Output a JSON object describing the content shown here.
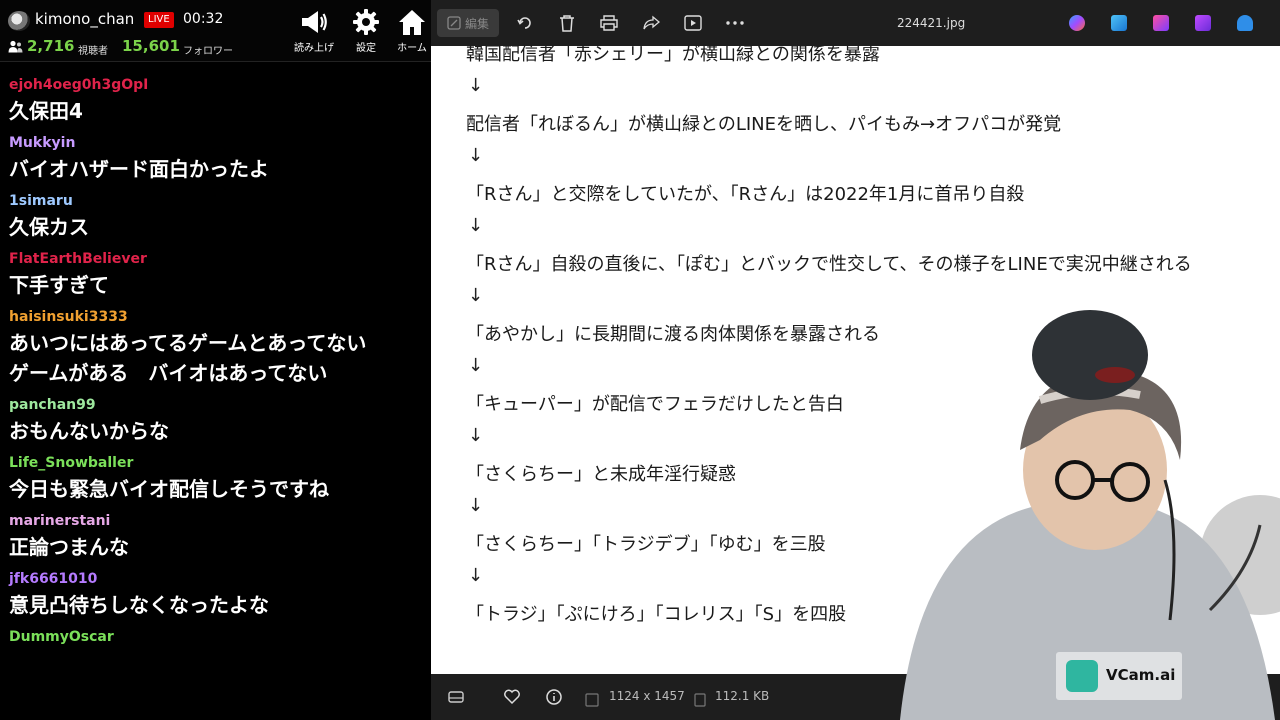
{
  "stream": {
    "channel_name": "kimono_chan",
    "live_badge": "LIVE",
    "elapsed": "00:32",
    "viewer_count": "2,716",
    "viewer_label": "視聴者",
    "follower_count": "15,601",
    "follower_label": "フォロワー"
  },
  "toolbar": {
    "readout_label": "読み上げ",
    "settings_label": "設定",
    "home_label": "ホーム"
  },
  "chat": [
    {
      "user": "ejoh4oeg0h3gOpI",
      "color": "#e0234a",
      "message": "久保田4"
    },
    {
      "user": "Mukkyin",
      "color": "#c79bff",
      "message": "バイオハザード面白かったよ"
    },
    {
      "user": "1simaru",
      "color": "#9ec9ff",
      "message": "久保カス"
    },
    {
      "user": "FlatEarthBeliever",
      "color": "#e0234a",
      "message": "下手すぎて"
    },
    {
      "user": "haisinsuki3333",
      "color": "#f0a030",
      "message": "あいつにはあってるゲームとあってない\nゲームがある　バイオはあってない"
    },
    {
      "user": "panchan99",
      "color": "#9ee89e",
      "message": "おもんないからな"
    },
    {
      "user": "Life_Snowballer",
      "color": "#7be05a",
      "message": "今日も緊急バイオ配信しそうですね"
    },
    {
      "user": "marinerstani",
      "color": "#e6a8e6",
      "message": "正論つまんな"
    },
    {
      "user": "jfk6661010",
      "color": "#b57bff",
      "message": "意見凸待ちしなくなったよな"
    },
    {
      "user": "DummyOscar",
      "color": "#7be05a",
      "message": ""
    }
  ],
  "viewer": {
    "edit_label": "編集",
    "file_name": "224421.jpg",
    "dimensions": "1124 x 1457",
    "file_size": "112.1 KB"
  },
  "document": {
    "lines": [
      "韓国配信者「赤シェリー」が横山緑との関係を暴露",
      "↓",
      "配信者「れぼるん」が横山緑とのLINEを晒し、パイもみ→オフパコが発覚",
      "↓",
      "「Rさん」と交際をしていたが、「Rさん」は2022年1月に首吊り自殺",
      "↓",
      "「Rさん」自殺の直後に、「ぽむ」とバックで性交して、その様子をLINEで実況中継される",
      "↓",
      "「あやかし」に長期間に渡る肉体関係を暴露される",
      "↓",
      "「キューパー」が配信でフェラだけしたと告白",
      "↓",
      "「さくらちー」と未成年淫行疑惑",
      "↓",
      "「さくらちー」「トラジデブ」「ゆむ」を三股",
      "↓",
      "「トラジ」「ぷにけろ」「コレリス」「S」を四股"
    ]
  },
  "overlay": {
    "vcam_text": "VCam.ai"
  },
  "icons": {
    "readout": "megaphone-icon",
    "settings": "gear-icon",
    "home": "home-icon",
    "viewers": "people-icon"
  }
}
